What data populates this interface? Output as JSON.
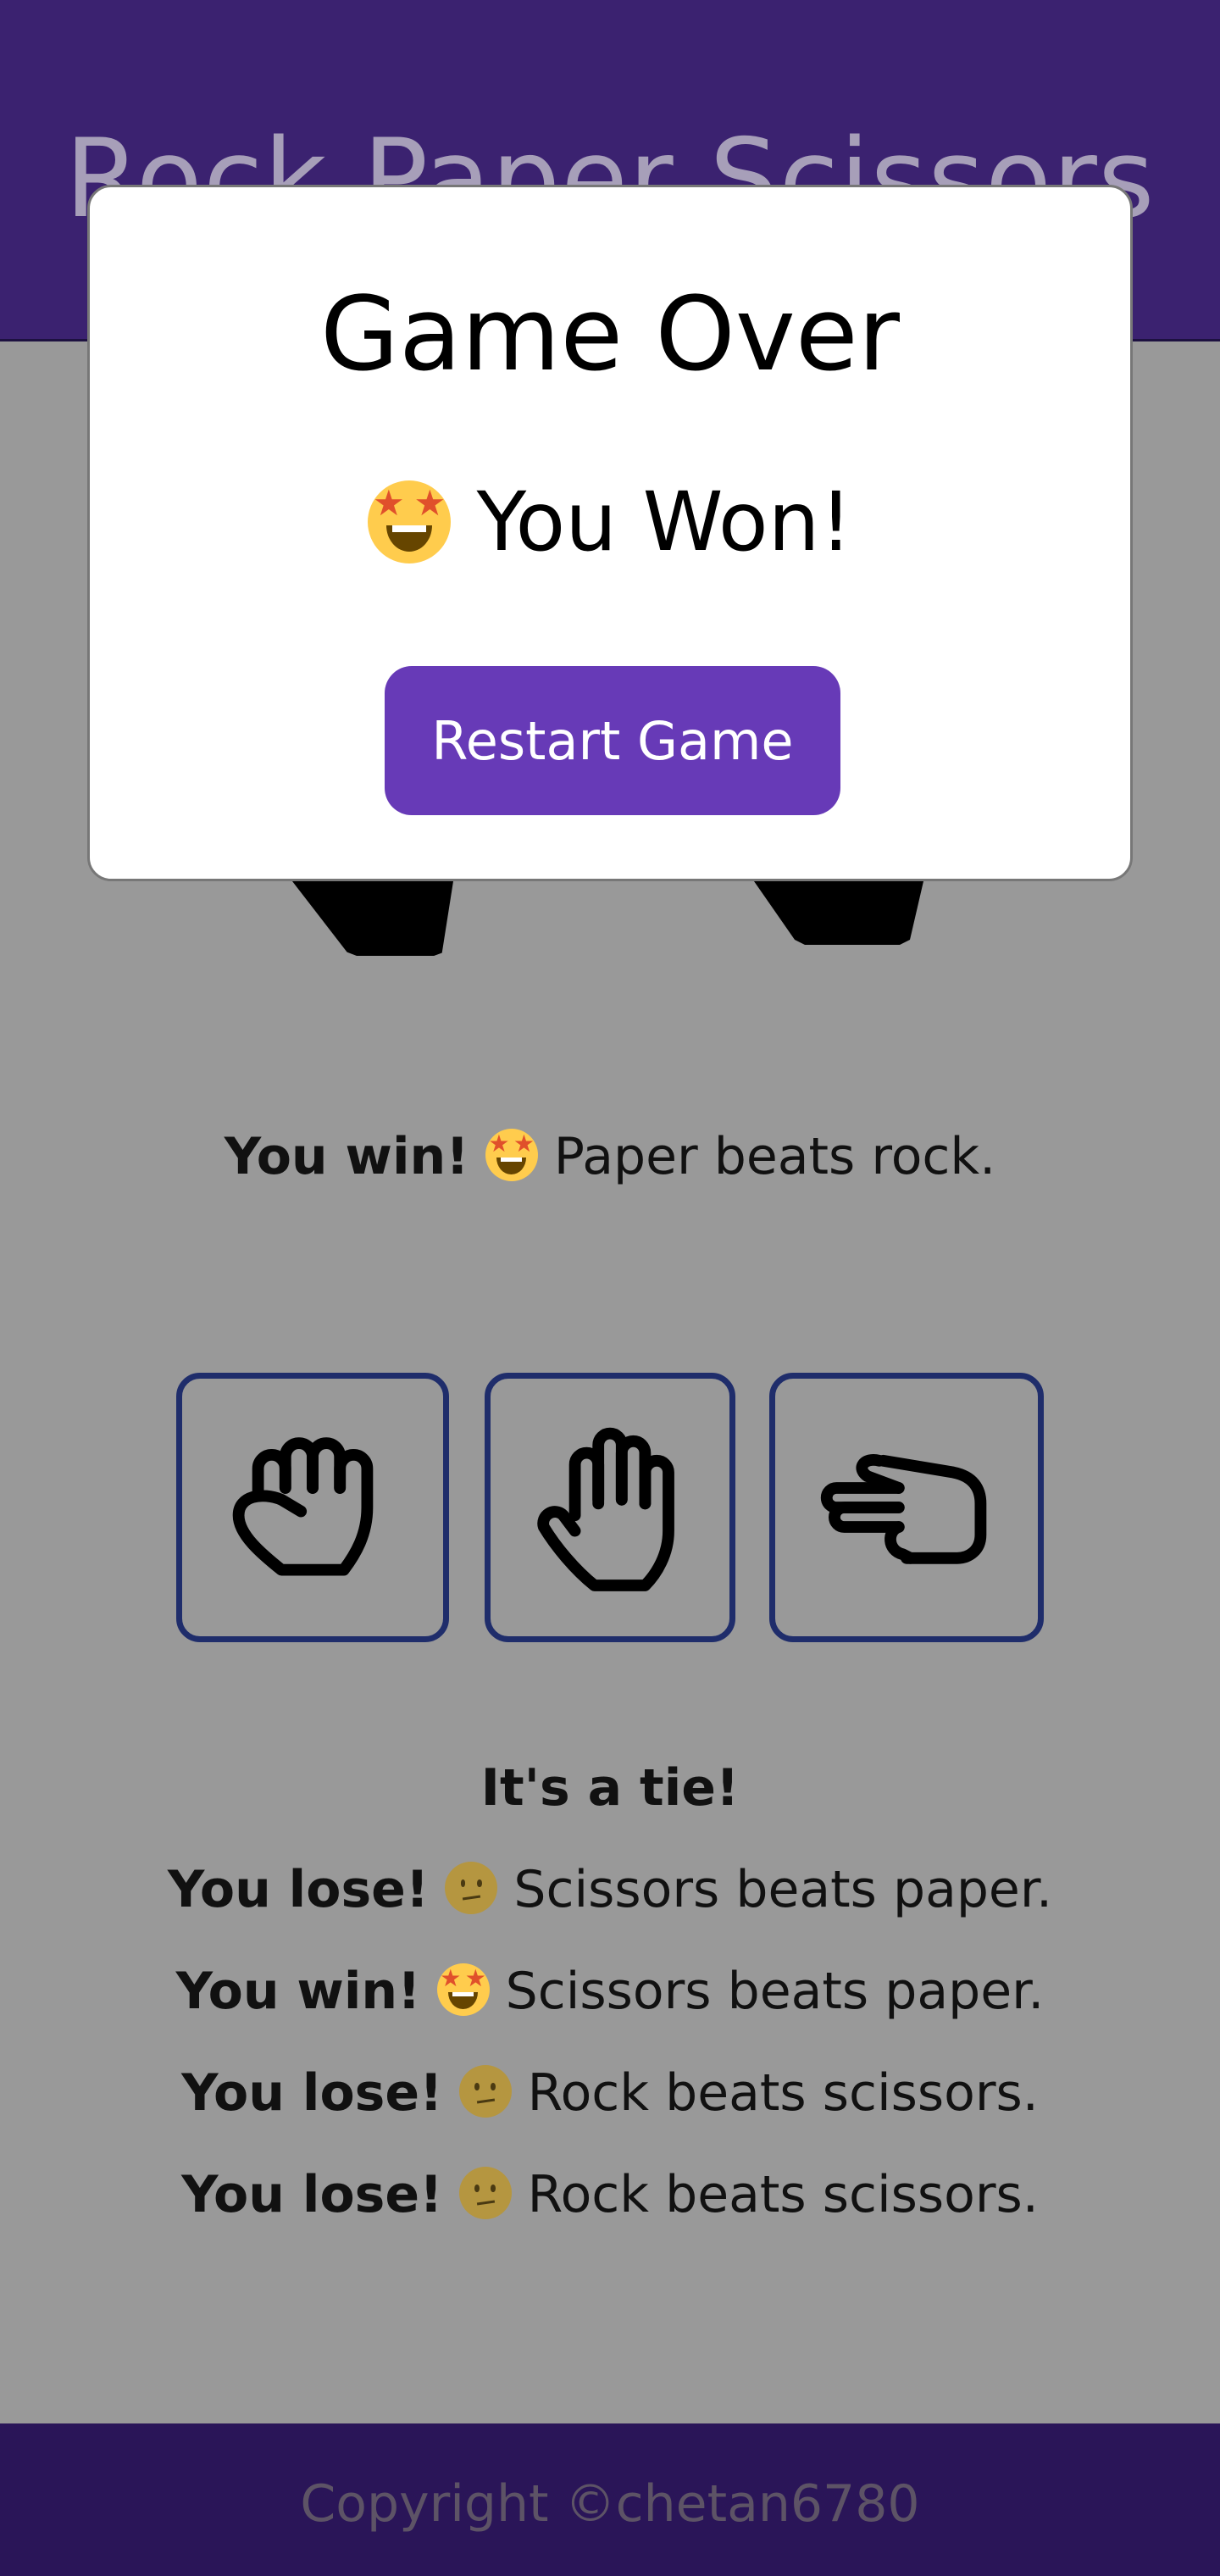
{
  "header": {
    "title": "Rock Paper Scissors"
  },
  "game": {
    "result": {
      "outcome": "You win!",
      "emoji": "star-struck-emoji",
      "detail": "Paper beats rock."
    },
    "choices": [
      {
        "name": "rock",
        "icon": "fist-icon"
      },
      {
        "name": "paper",
        "icon": "open-hand-icon"
      },
      {
        "name": "scissors",
        "icon": "pointing-hand-icon"
      }
    ],
    "history": [
      {
        "text": "It's a tie!"
      },
      {
        "outcome": "You lose!",
        "emoji": "confused-emoji",
        "detail": "Scissors beats paper."
      },
      {
        "outcome": "You win!",
        "emoji": "star-struck-emoji",
        "detail": "Scissors beats paper."
      },
      {
        "outcome": "You lose!",
        "emoji": "confused-emoji",
        "detail": "Rock beats scissors."
      },
      {
        "outcome": "You lose!",
        "emoji": "confused-emoji",
        "detail": "Rock beats scissors."
      }
    ]
  },
  "modal": {
    "title": "Game Over",
    "message": "You Won!",
    "emoji": "star-struck-emoji",
    "button_label": "Restart Game"
  },
  "footer": {
    "text": "Copyright ©chetan6780"
  },
  "colors": {
    "header_bg": "#3b2270",
    "page_bg": "#999999",
    "footer_bg": "#2a1558",
    "button_bg": "#673ab7",
    "choice_border": "#1f2d6b"
  }
}
